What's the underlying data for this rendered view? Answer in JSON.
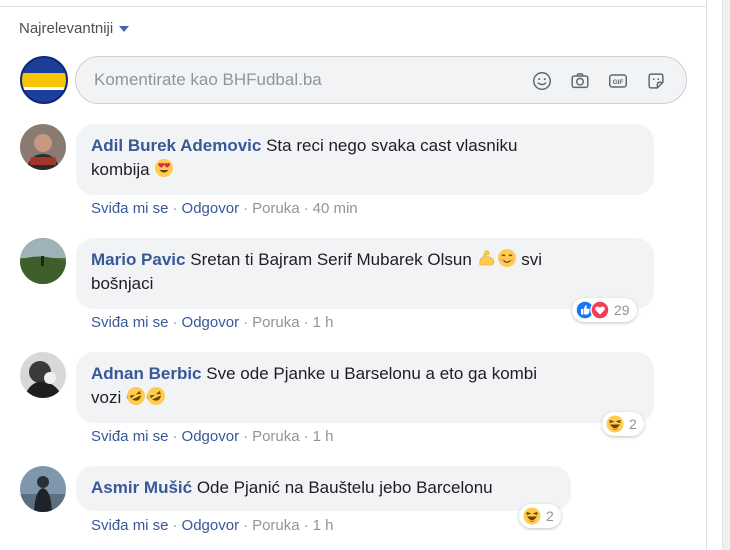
{
  "sort": {
    "label": "Najrelevantniji"
  },
  "composer": {
    "placeholder": "Komentirate kao BHFudbal.ba",
    "icons": [
      "emoji-icon",
      "camera-icon",
      "gif-icon",
      "sticker-icon"
    ]
  },
  "action_labels": {
    "like": "Sviđa mi se",
    "reply": "Odgovor",
    "message": "Poruka"
  },
  "comments": [
    {
      "author": "Adil Burek Ademovic",
      "text1": "Sta reci nego svaka cast vlasniku",
      "text2": "kombija",
      "emoji": "heart-eyes-emoji",
      "time": "40 min"
    },
    {
      "author": "Mario Pavic",
      "text1": "Sretan ti Bajram Serif Mubarek Olsun",
      "text1_after": "svi",
      "text2": "bošnjaci",
      "emoji": [
        "flexed-biceps-emoji",
        "smiling-face-emoji"
      ],
      "time": "1 h",
      "reactions": {
        "icons": [
          "like-reaction-icon",
          "love-reaction-icon"
        ],
        "count": "29"
      }
    },
    {
      "author": "Adnan Berbic",
      "text1": "Sve ode Pjanke u Barselonu a eto ga kombi",
      "text2": "vozi",
      "emoji": [
        "rolling-laughing-emoji",
        "rolling-laughing-emoji"
      ],
      "time": "1 h",
      "reactions": {
        "icons": [
          "haha-reaction-icon"
        ],
        "count": "2"
      }
    },
    {
      "author": "Asmir Mušić",
      "text1": "Ode Pjanić na Bauštelu jebo Barcelonu",
      "time": "1 h",
      "reactions": {
        "icons": [
          "haha-reaction-icon"
        ],
        "count": "2"
      }
    }
  ]
}
